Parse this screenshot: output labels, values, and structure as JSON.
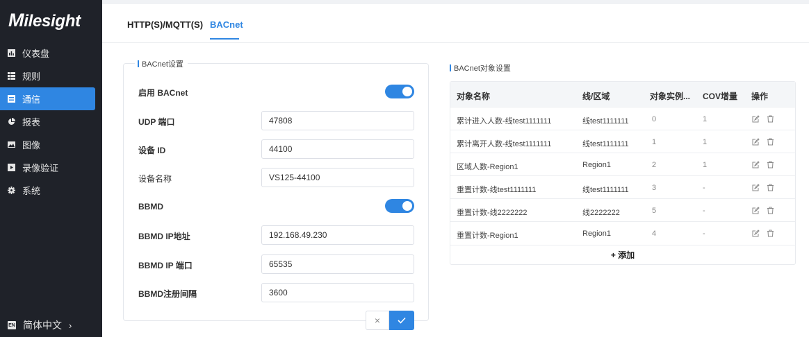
{
  "brand": {
    "logo_first": "M",
    "logo_rest": "ilesight"
  },
  "sidebar": {
    "items": [
      {
        "label": "仪表盘",
        "icon": "dashboard-icon"
      },
      {
        "label": "规则",
        "icon": "rules-icon"
      },
      {
        "label": "通信",
        "icon": "communication-icon"
      },
      {
        "label": "报表",
        "icon": "report-icon"
      },
      {
        "label": "图像",
        "icon": "image-icon"
      },
      {
        "label": "录像验证",
        "icon": "video-icon"
      },
      {
        "label": "系统",
        "icon": "gear-icon"
      }
    ],
    "active_index": 2,
    "language": {
      "badge": "EN",
      "label": "简体中文",
      "chevron": "›"
    }
  },
  "tabs": [
    {
      "label": "HTTP(S)/MQTT(S)"
    },
    {
      "label": "BACnet"
    }
  ],
  "bacnet_settings": {
    "title": "BACnet设置",
    "enable_label": "启用 BACnet",
    "enable_on": true,
    "udp_label": "UDP 端口",
    "udp_value": "47808",
    "device_id_label": "设备 ID",
    "device_id_value": "44100",
    "device_name_label": "设备名称",
    "device_name_value": "VS125-44100",
    "bbmd_label": "BBMD",
    "bbmd_on": true,
    "bbmd_ip_label": "BBMD IP地址",
    "bbmd_ip_value": "192.168.49.230",
    "bbmd_port_label": "BBMD IP 端口",
    "bbmd_port_value": "65535",
    "bbmd_interval_label": "BBMD注册间隔",
    "bbmd_interval_value": "3600",
    "cancel_symbol": "×"
  },
  "objects": {
    "title": "BACnet对象设置",
    "columns": [
      "对象名称",
      "线/区域",
      "对象实例...",
      "COV增量",
      "操作"
    ],
    "rows": [
      {
        "name": "累计进入人数-线test1111111",
        "area": "线test1111111",
        "instance": "0",
        "cov": "1"
      },
      {
        "name": "累计离开人数-线test1111111",
        "area": "线test1111111",
        "instance": "1",
        "cov": "1"
      },
      {
        "name": "区域人数-Region1",
        "area": "Region1",
        "instance": "2",
        "cov": "1"
      },
      {
        "name": "重置计数-线test1111111",
        "area": "线test1111111",
        "instance": "3",
        "cov": "-"
      },
      {
        "name": "重置计数-线2222222",
        "area": "线2222222",
        "instance": "5",
        "cov": "-"
      },
      {
        "name": "重置计数-Region1",
        "area": "Region1",
        "instance": "4",
        "cov": "-"
      }
    ],
    "add_label": "+ 添加"
  },
  "colors": {
    "accent": "#2f86e2",
    "sidebar": "#1f2229"
  }
}
